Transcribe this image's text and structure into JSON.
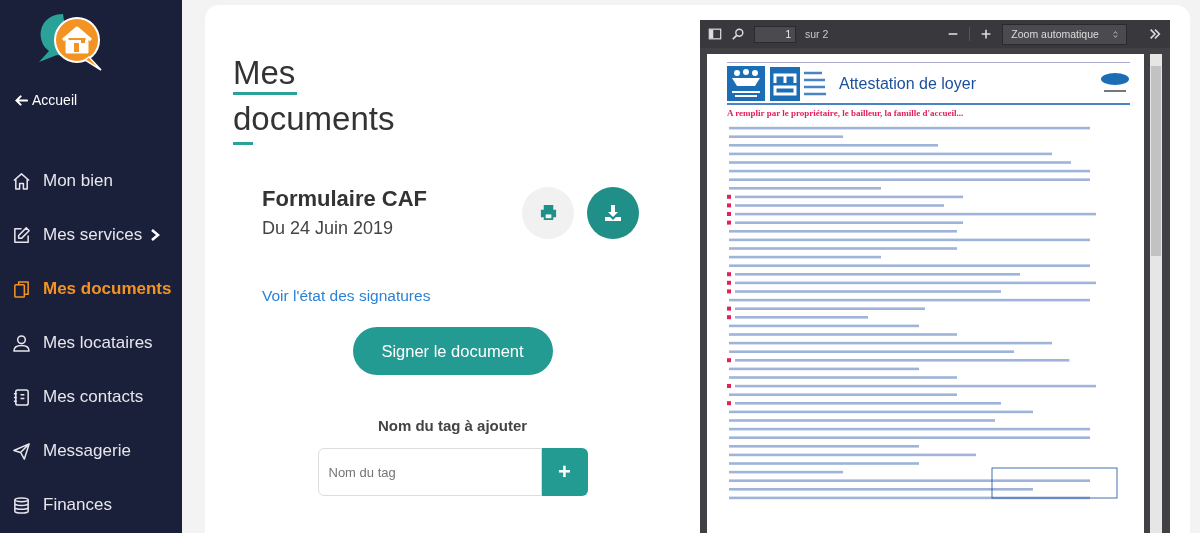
{
  "sidebar": {
    "home_link": "Accueil",
    "items": [
      {
        "label": "Mon bien",
        "selected": false,
        "has_submenu": false
      },
      {
        "label": "Mes services",
        "selected": false,
        "has_submenu": true
      },
      {
        "label": "Mes documents",
        "selected": true,
        "has_submenu": false
      },
      {
        "label": "Mes locataires",
        "selected": false,
        "has_submenu": false
      },
      {
        "label": "Mes contacts",
        "selected": false,
        "has_submenu": false
      },
      {
        "label": "Messagerie",
        "selected": false,
        "has_submenu": false
      },
      {
        "label": "Finances",
        "selected": false,
        "has_submenu": false
      }
    ]
  },
  "page_title": "Mes documents",
  "document": {
    "title": "Formulaire CAF",
    "date": "Du 24 Juin 2019",
    "signatures_link": "Voir l'état des signatures",
    "sign_button": "Signer le document"
  },
  "tag_form": {
    "label": "Nom du tag à ajouter",
    "placeholder": "Nom du tag",
    "add_button": "+"
  },
  "pdf_viewer": {
    "page_number": "1",
    "page_count": "sur 2",
    "zoom": "Zoom automatique",
    "page": {
      "title": "Attestation de loyer",
      "heading": "A remplir par le propriétaire, le bailleur, la famille d'accueil..."
    }
  }
}
